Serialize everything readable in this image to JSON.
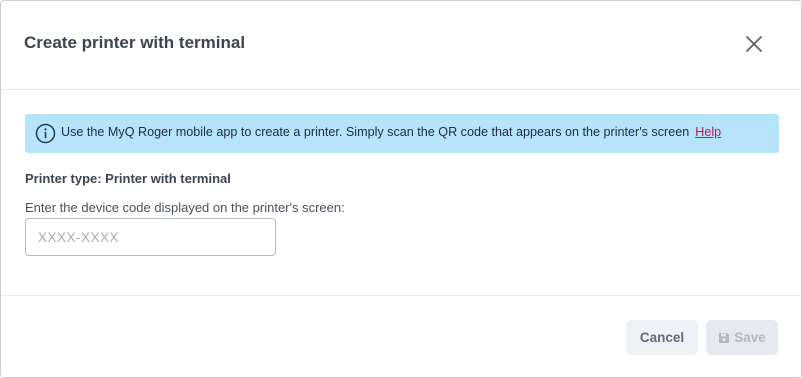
{
  "dialog": {
    "title": "Create printer with terminal",
    "close_icon": "close-icon"
  },
  "info": {
    "icon": "info-circle-icon",
    "text": "Use the MyQ Roger mobile app to create a printer. Simply scan the QR code that appears on the printer's screen",
    "help_label": "Help"
  },
  "form": {
    "printer_type": "Printer type: Printer with terminal",
    "code_label": "Enter the device code displayed on the printer's screen:",
    "code_value": "",
    "code_placeholder": "XXXX-XXXX"
  },
  "footer": {
    "cancel_label": "Cancel",
    "save_label": "Save",
    "save_icon": "floppy-disk-icon"
  },
  "colors": {
    "info_background": "#b6e4fb",
    "link": "#c2185b",
    "title": "#3d4354"
  }
}
